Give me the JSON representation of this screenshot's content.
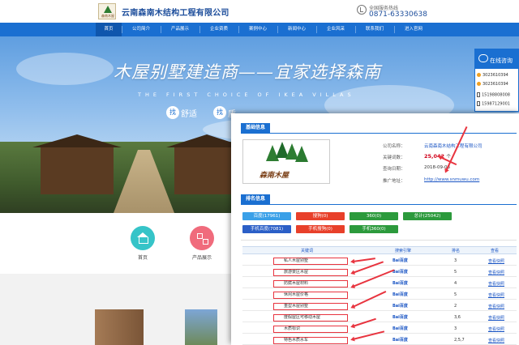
{
  "header": {
    "logo_text": "森南木屋",
    "company_name": "云南森南木结构工程有限公司",
    "hotline_label": "全国服务热线",
    "hotline_number": "0871-63330638"
  },
  "nav": {
    "items": [
      "首页",
      "公司简介",
      "产品展示",
      "企业资质",
      "案例中心",
      "新闻中心",
      "企业风采",
      "联系我们",
      "进入官网"
    ]
  },
  "banner": {
    "slogan": "木屋别墅建造商——宜家选择森南",
    "slogan_en": "THE FIRST CHOICE OF IKEA VILLAS",
    "tags": [
      {
        "char": "找",
        "text": "舒适"
      },
      {
        "char": "找",
        "text": "质"
      }
    ]
  },
  "icons": {
    "items": [
      {
        "label": "首页",
        "icon": "home-icon"
      },
      {
        "label": "产品展示",
        "icon": "product-icon"
      }
    ]
  },
  "float_widget": {
    "title": "在线咨询",
    "qq": [
      "3023610394",
      "3023610394"
    ],
    "phones": [
      "15198808008",
      "15987129001"
    ]
  },
  "report": {
    "basic_tab": "基础信息",
    "logo_text": "森南木屋",
    "company_label": "公司名称：",
    "company_value": "云南森南木结构工程有限公司",
    "keywords_label": "关键词数：",
    "keywords_value": "25,042",
    "keywords_suffix": "个",
    "date_label": "查询日期：",
    "date_value": "2018-09-03",
    "url_label": "推广地址：",
    "url_value": "http://www.snmuwu.com",
    "rank_tab": "排名信息",
    "pills": [
      {
        "label": "百度(17961)",
        "color": "#3aa0e8"
      },
      {
        "label": "搜狗(0)",
        "color": "#e8402a"
      },
      {
        "label": "360(0)",
        "color": "#2c9a3c"
      },
      {
        "label": "总计(25042)",
        "color": "#2c9a3c"
      },
      {
        "label": "手机百度(7081)",
        "color": "#2b5fc7"
      },
      {
        "label": "手机搜狗(0)",
        "color": "#e8402a"
      },
      {
        "label": "手机360(0)",
        "color": "#2c9a3c"
      }
    ],
    "table": {
      "headers": [
        "关键词",
        "搜索引擎",
        "排名",
        "查看"
      ],
      "engine": "Bai",
      "engine_suffix": "百度",
      "link_text": "查看快照",
      "rows": [
        {
          "keyword": "私人木屋别墅",
          "rank": "3"
        },
        {
          "keyword": "旅游景区木屋",
          "rank": "5"
        },
        {
          "keyword": "防腐木屋材料",
          "rank": "4"
        },
        {
          "keyword": "休闲木屋价格",
          "rank": "5"
        },
        {
          "keyword": "重型木屋别墅",
          "rank": "2"
        },
        {
          "keyword": "度假屋区可移动木屋",
          "rank": "3,6"
        },
        {
          "keyword": "木质标识",
          "rank": "3"
        },
        {
          "keyword": "特色木质水车",
          "rank": "2,5,7"
        }
      ]
    }
  }
}
